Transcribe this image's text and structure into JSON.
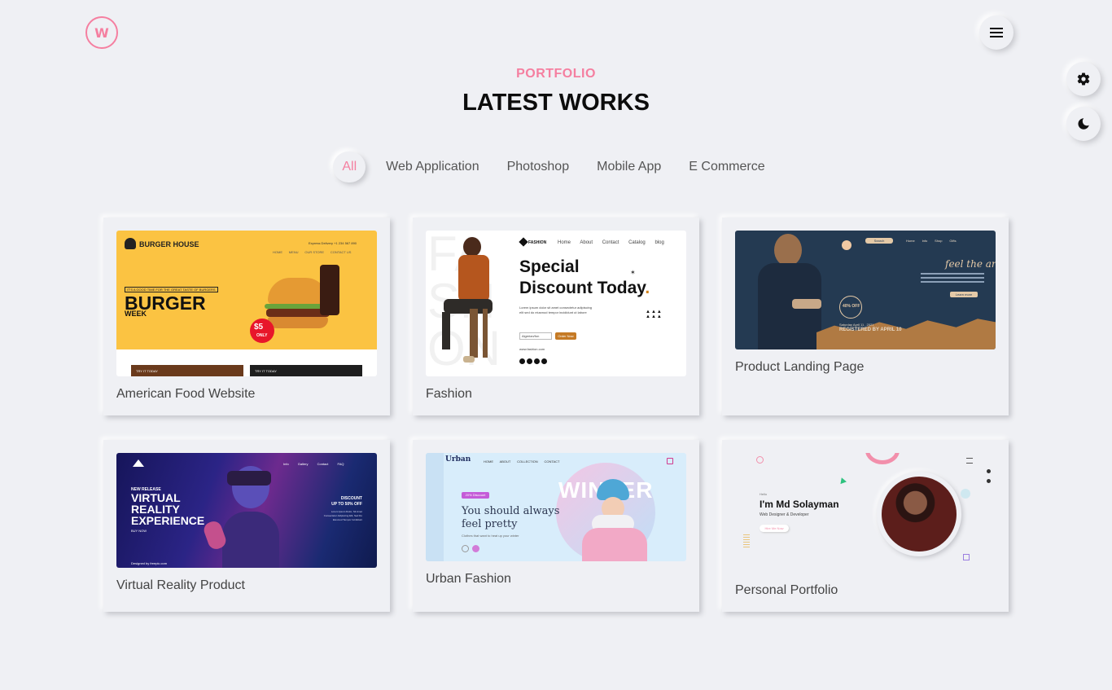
{
  "header": {
    "logo_letter": "W",
    "eyebrow": "PORTFOLIO",
    "title": "LATEST WORKS"
  },
  "icons": {
    "menu": "hamburger-icon",
    "settings": "gear-icon",
    "theme": "moon-icon"
  },
  "colors": {
    "accent": "#f57fa0",
    "background": "#eff0f4"
  },
  "filters": [
    "All",
    "Web Application",
    "Photoshop",
    "Mobile App",
    "E Commerce"
  ],
  "active_filter": "All",
  "projects": [
    {
      "label": "American Food Website",
      "thumb": {
        "brand": "BURGER HOUSE",
        "delivery": "Express Delivery +1 234 567 890",
        "nav": [
          "HOME",
          "MENU",
          "OUR STORE",
          "CONTACT US"
        ],
        "tagline": "IT'S A GOOD TIME FOR THE GREAT TASTE OF BURGERS",
        "headline": "BURGER",
        "sub": "WEEK",
        "price": "$5",
        "price_note": "ONLY",
        "tile1": "TRY IT TODAY",
        "tile2": "TRY IT TODAY"
      }
    },
    {
      "label": "Fashion",
      "thumb": {
        "brand": "FASHION",
        "nav": [
          "Home",
          "About",
          "Contact",
          "Catalog",
          "blog"
        ],
        "headline1": "Special",
        "headline2": "Discount Today",
        "body": "Lorem ipsum dolor sit amet consectetur adipiscing elit sed do eiusmod tempor incididunt ut labore",
        "select": "Algerian/fon",
        "button": "Order Now",
        "url": "www.fashion.com"
      }
    },
    {
      "label": "Product Landing Page",
      "thumb": {
        "nav": [
          "Home",
          "Info",
          "Shop",
          "Gifts"
        ],
        "button": "Search",
        "script_title": "feel the art",
        "badge": "40% OFF",
        "date": "Saturday April 11 , 2021",
        "deadline": "REGISTERED BY APRIL 10",
        "cta": "Learn more"
      }
    },
    {
      "label": "Virtual Reality Product",
      "thumb": {
        "nav": [
          "Info",
          "Gallery",
          "Contact",
          "FAQ"
        ],
        "kicker": "NEW RELEASE",
        "headline": [
          "VIRTUAL",
          "REALITY",
          "EXPERIENCE"
        ],
        "buy": "BUY NOW",
        "discount": "DISCOUNT",
        "discount_amount": "UP TO 50% OFF",
        "discount_body": "Lorem Ipsum Dolor, Sit Amet Consectetur Adipiscing Elit, Sed Do Eiusmod Tempor Incididunt",
        "credit": "Designed by freepic.com"
      }
    },
    {
      "label": "Urban Fashion",
      "thumb": {
        "brand": "Urban",
        "nav": [
          "HOME",
          "ABOUT",
          "COLLECTION",
          "CONTACT"
        ],
        "badge": "20% Discount",
        "backword": "WINTER",
        "headline1": "You should always",
        "headline2": "feel pretty",
        "body": "Clothes that want to heat up your winter"
      }
    },
    {
      "label": "Personal Portfolio",
      "thumb": {
        "hello": "Hello",
        "name": "I'm Md Solayman",
        "role": "Web Designer & Developer",
        "button": "Hire Me Now"
      }
    }
  ]
}
